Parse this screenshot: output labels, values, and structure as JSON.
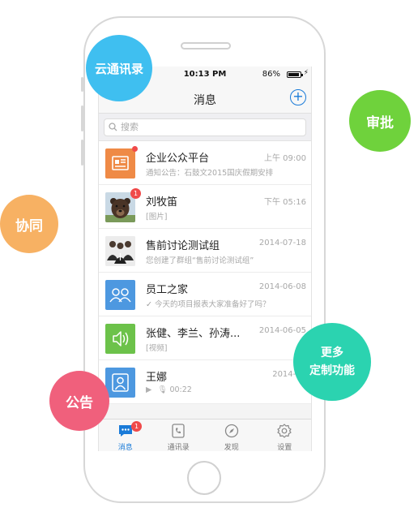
{
  "status": {
    "time": "10:13 PM",
    "battery": "86%"
  },
  "nav": {
    "title": "消息",
    "add": "+"
  },
  "search": {
    "placeholder": "搜索"
  },
  "messages": [
    {
      "name": "企业公众平台",
      "time": "上午 09:00",
      "preview": "通知公告：石鼓文2015国庆假期安排",
      "icon": "newspaper-icon",
      "color": "#ef8a46"
    },
    {
      "name": "刘牧笛",
      "time": "下午 05:16",
      "preview": "[图片]",
      "badge": "1",
      "icon": "bear-avatar"
    },
    {
      "name": "售前讨论测试组",
      "time": "2014-07-18",
      "preview": "您创建了群组“售前讨论测试组”",
      "icon": "group-photo-avatar"
    },
    {
      "name": "员工之家",
      "time": "2014-06-08",
      "preview": "今天的项目报表大家准备好了吗？",
      "icon": "people-icon",
      "color": "#4d98e0"
    },
    {
      "name": "张健、李兰、孙涛...",
      "time": "2014-06-05",
      "preview": "[视频]",
      "icon": "speaker-icon",
      "color": "#6cc24a"
    },
    {
      "name": "王娜",
      "time": "2014-06",
      "preview": "00:22",
      "icon": "person-icon",
      "color": "#4d98e0"
    }
  ],
  "tabs": [
    {
      "label": "消息",
      "badge": "1",
      "icon": "chat-icon"
    },
    {
      "label": "通讯录",
      "icon": "phone-book-icon"
    },
    {
      "label": "发现",
      "icon": "compass-icon"
    },
    {
      "label": "设置",
      "icon": "gear-icon"
    }
  ],
  "bubbles": {
    "contacts": "云通讯录",
    "approve": "审批",
    "collab": "协同",
    "more_1": "更多",
    "more_2": "定制功能",
    "notice": "公告"
  },
  "colors": {
    "contacts": "#3fbff0",
    "approve": "#6fd23c",
    "collab": "#f7b163",
    "more": "#2bd3b0",
    "notice": "#f0607c",
    "accent": "#1a7bd8"
  }
}
